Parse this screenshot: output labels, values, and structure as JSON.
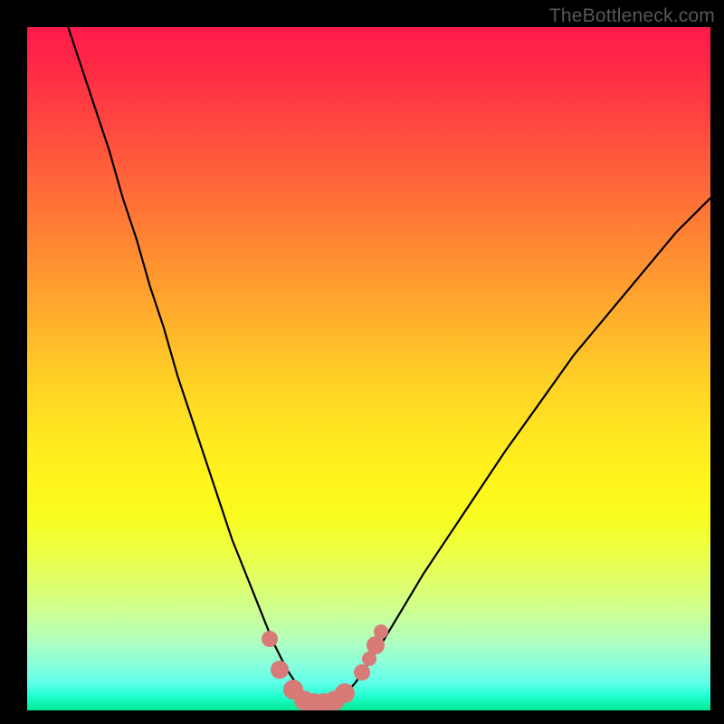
{
  "watermark": "TheBottleneck.com",
  "chart_data": {
    "type": "line",
    "title": "",
    "xlabel": "",
    "ylabel": "",
    "xlim": [
      0,
      100
    ],
    "ylim": [
      0,
      100
    ],
    "background_gradient": {
      "top": "#ff1a4b",
      "middle": "#ffe820",
      "bottom": "#00e98f"
    },
    "curve": {
      "comment": "V-shaped curve; values are normalized x,y in 0..100 (y=0 bottom). The curve dips to ~0 near x≈42 then rises again.",
      "points": [
        [
          6,
          100
        ],
        [
          8,
          94
        ],
        [
          10,
          88
        ],
        [
          12,
          82
        ],
        [
          14,
          75
        ],
        [
          16,
          69
        ],
        [
          18,
          62
        ],
        [
          20,
          56
        ],
        [
          22,
          49
        ],
        [
          24,
          43
        ],
        [
          26,
          37
        ],
        [
          28,
          31
        ],
        [
          30,
          25
        ],
        [
          32,
          20
        ],
        [
          34,
          15
        ],
        [
          36,
          10
        ],
        [
          38,
          6
        ],
        [
          40,
          3
        ],
        [
          41,
          1.5
        ],
        [
          42,
          0.8
        ],
        [
          43,
          0.5
        ],
        [
          44,
          0.6
        ],
        [
          45,
          1.0
        ],
        [
          46,
          1.8
        ],
        [
          48,
          4
        ],
        [
          50,
          7
        ],
        [
          52,
          10
        ],
        [
          55,
          15
        ],
        [
          58,
          20
        ],
        [
          62,
          26
        ],
        [
          66,
          32
        ],
        [
          70,
          38
        ],
        [
          75,
          45
        ],
        [
          80,
          52
        ],
        [
          85,
          58
        ],
        [
          90,
          64
        ],
        [
          95,
          70
        ],
        [
          100,
          75
        ]
      ]
    },
    "markers": {
      "comment": "pink circular markers clustered near the valley of the curve",
      "color": "#d87a78",
      "points": [
        {
          "x": 35.5,
          "y": 10.5,
          "r": 9
        },
        {
          "x": 37.0,
          "y": 6.0,
          "r": 10
        },
        {
          "x": 39.0,
          "y": 3.0,
          "r": 11
        },
        {
          "x": 40.5,
          "y": 1.5,
          "r": 11
        },
        {
          "x": 42.0,
          "y": 1.0,
          "r": 11
        },
        {
          "x": 43.5,
          "y": 1.0,
          "r": 11
        },
        {
          "x": 45.0,
          "y": 1.5,
          "r": 11
        },
        {
          "x": 46.5,
          "y": 2.5,
          "r": 11
        },
        {
          "x": 49.0,
          "y": 5.5,
          "r": 9
        },
        {
          "x": 50.0,
          "y": 7.5,
          "r": 8
        },
        {
          "x": 51.0,
          "y": 9.5,
          "r": 10
        },
        {
          "x": 51.8,
          "y": 11.5,
          "r": 8
        }
      ]
    }
  }
}
